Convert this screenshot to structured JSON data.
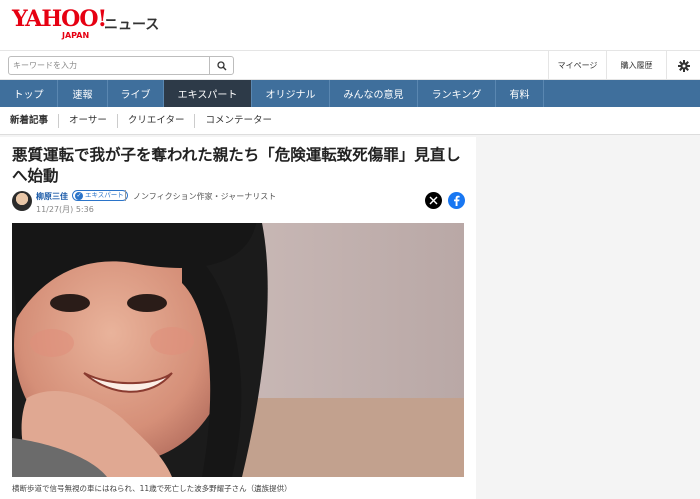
{
  "header": {
    "logo_main": "YAHOO!",
    "logo_sub": "JAPAN",
    "section": "ニュース"
  },
  "search": {
    "placeholder": "キーワードを入力",
    "icon": "search-icon"
  },
  "header_links": {
    "mypage": "マイページ",
    "history": "購入履歴",
    "settings_icon": "gear-icon"
  },
  "main_nav": [
    {
      "label": "トップ",
      "active": false
    },
    {
      "label": "速報",
      "active": false
    },
    {
      "label": "ライブ",
      "active": false
    },
    {
      "label": "エキスパート",
      "active": true
    },
    {
      "label": "オリジナル",
      "active": false
    },
    {
      "label": "みんなの意見",
      "active": false
    },
    {
      "label": "ランキング",
      "active": false
    },
    {
      "label": "有料",
      "active": false
    }
  ],
  "sub_nav": [
    {
      "label": "新着記事",
      "active": true
    },
    {
      "label": "オーサー",
      "active": false
    },
    {
      "label": "クリエイター",
      "active": false
    },
    {
      "label": "コメンテーター",
      "active": false
    }
  ],
  "article": {
    "headline": "悪質運転で我が子を奪われた親たち「危険運転致死傷罪」見直しへ始動",
    "author": "柳原三佳",
    "badge": "エキスパート",
    "role": "ノンフィクション作家・ジャーナリスト",
    "date": "11/27(月) 5:36",
    "caption": "横断歩道で信号無視の車にはねられ、11歳で死亡した波多野耀子さん（遺族提供）"
  },
  "share": {
    "x_icon": "x-icon",
    "facebook_icon": "facebook-icon"
  },
  "colors": {
    "nav_bg": "#3f6f9c",
    "nav_active": "#2d3a48",
    "brand_red": "#e60012",
    "facebook": "#1877f2"
  }
}
